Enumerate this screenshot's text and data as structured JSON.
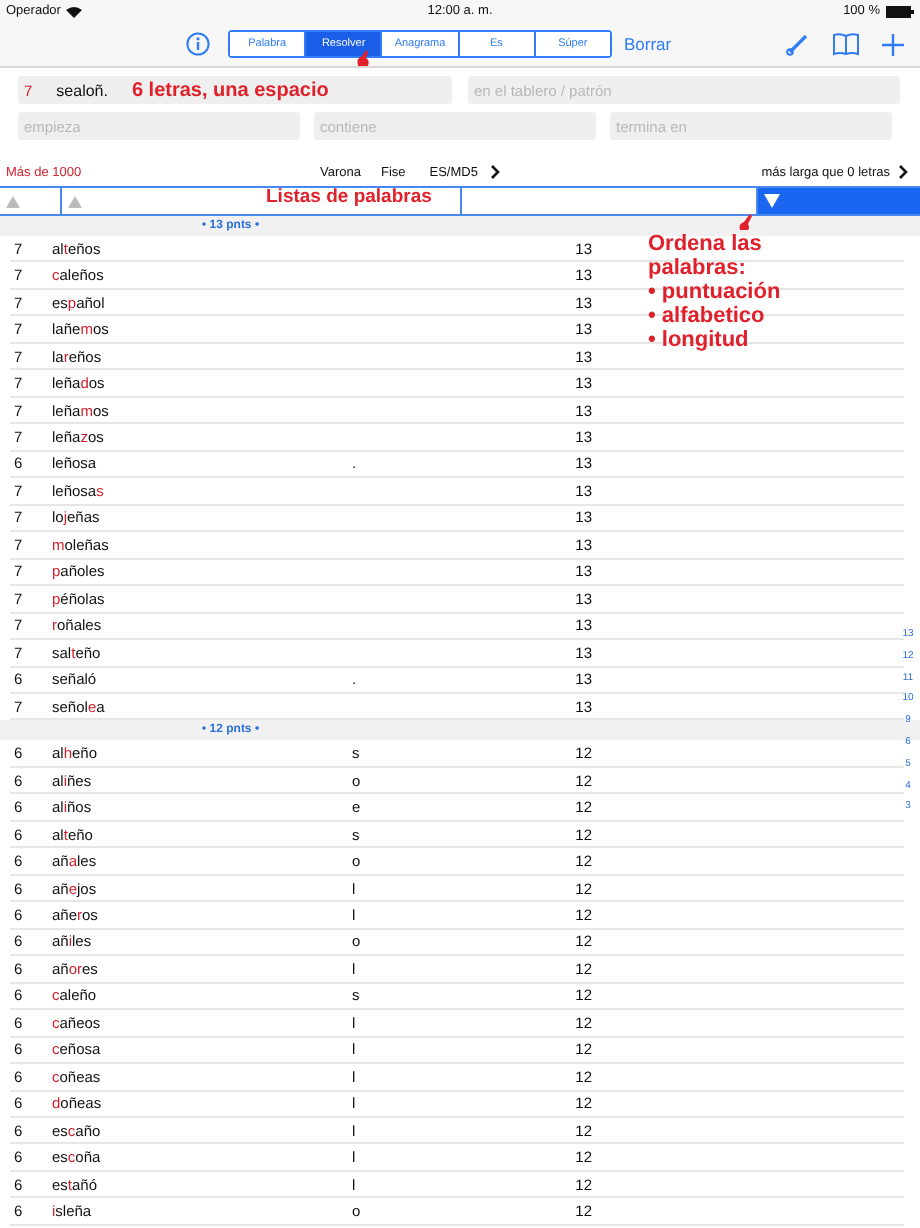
{
  "status_bar": {
    "carrier": "Operador",
    "time": "12:00 a. m.",
    "battery": "100 %"
  },
  "toolbar": {
    "modes": [
      {
        "label": "Palabra",
        "selected": false
      },
      {
        "label": "Resolver",
        "selected": true
      },
      {
        "label": "Anagrama",
        "selected": false
      },
      {
        "label": "Es",
        "selected": false
      },
      {
        "label": "Súper",
        "selected": false
      }
    ],
    "clear_button": "Borrar"
  },
  "search": {
    "count": "7",
    "value": "sealoñ.",
    "annotation": "6 letras, una espacio",
    "pattern_placeholder": "en el tablero / patrón",
    "starts_placeholder": "empieza",
    "contains_placeholder": "contiene",
    "ends_placeholder": "termina en"
  },
  "filters": {
    "result_count": "Más de 1000",
    "dictionaries": [
      "Varona",
      "Fise",
      "ES/MD5"
    ],
    "length_filter": "más larga que 0 letras"
  },
  "sort_header": {
    "annotation": "Listas de palabras",
    "columns": [
      {
        "arrow": true,
        "selected": false
      },
      {
        "arrow": true,
        "selected": false
      },
      {
        "arrow": false,
        "selected": false
      },
      {
        "arrow": true,
        "selected": true
      }
    ]
  },
  "sort_note": [
    "Ordena las",
    "palabras:",
    "• puntuación",
    "• alfabetico",
    "• longitud"
  ],
  "groups": [
    {
      "header": "• 13 pnts •",
      "rows": [
        {
          "length": "7",
          "word": [
            {
              "text": "al",
              "red": false
            },
            {
              "text": "t",
              "red": true
            },
            {
              "text": "eños",
              "red": false
            }
          ],
          "score": "13"
        },
        {
          "length": "7",
          "word": [
            {
              "text": "c",
              "red": true
            },
            {
              "text": "aleños",
              "red": false
            }
          ],
          "score": "13"
        },
        {
          "length": "7",
          "word": [
            {
              "text": "es",
              "red": false
            },
            {
              "text": "p",
              "red": true
            },
            {
              "text": "añol",
              "red": false
            }
          ],
          "score": "13"
        },
        {
          "length": "7",
          "word": [
            {
              "text": "lañe",
              "red": false
            },
            {
              "text": "m",
              "red": true
            },
            {
              "text": "os",
              "red": false
            }
          ],
          "score": "13"
        },
        {
          "length": "7",
          "word": [
            {
              "text": "la",
              "red": false
            },
            {
              "text": "r",
              "red": true
            },
            {
              "text": "eños",
              "red": false
            }
          ],
          "score": "13"
        },
        {
          "length": "7",
          "word": [
            {
              "text": "leña",
              "red": false
            },
            {
              "text": "d",
              "red": true
            },
            {
              "text": "os",
              "red": false
            }
          ],
          "score": "13"
        },
        {
          "length": "7",
          "word": [
            {
              "text": "leña",
              "red": false
            },
            {
              "text": "m",
              "red": true
            },
            {
              "text": "os",
              "red": false
            }
          ],
          "score": "13"
        },
        {
          "length": "7",
          "word": [
            {
              "text": "leña",
              "red": false
            },
            {
              "text": "z",
              "red": true
            },
            {
              "text": "os",
              "red": false
            }
          ],
          "score": "13"
        },
        {
          "length": "6",
          "word": [
            {
              "text": "leñosa",
              "red": false
            }
          ],
          "extra": ".",
          "score": "13"
        },
        {
          "length": "7",
          "word": [
            {
              "text": "leñosa",
              "red": false
            },
            {
              "text": "s",
              "red": true
            }
          ],
          "score": "13"
        },
        {
          "length": "7",
          "word": [
            {
              "text": "lo",
              "red": false
            },
            {
              "text": "j",
              "red": true
            },
            {
              "text": "eñas",
              "red": false
            }
          ],
          "score": "13"
        },
        {
          "length": "7",
          "word": [
            {
              "text": "m",
              "red": true
            },
            {
              "text": "oleñas",
              "red": false
            }
          ],
          "score": "13"
        },
        {
          "length": "7",
          "word": [
            {
              "text": "p",
              "red": true
            },
            {
              "text": "añoles",
              "red": false
            }
          ],
          "score": "13"
        },
        {
          "length": "7",
          "word": [
            {
              "text": "p",
              "red": true
            },
            {
              "text": "éñolas",
              "red": false
            }
          ],
          "score": "13"
        },
        {
          "length": "7",
          "word": [
            {
              "text": "r",
              "red": true
            },
            {
              "text": "oñales",
              "red": false
            }
          ],
          "score": "13"
        },
        {
          "length": "7",
          "word": [
            {
              "text": "sal",
              "red": false
            },
            {
              "text": "t",
              "red": true
            },
            {
              "text": "eño",
              "red": false
            }
          ],
          "score": "13"
        },
        {
          "length": "6",
          "word": [
            {
              "text": "señaló",
              "red": false
            }
          ],
          "extra": ".",
          "score": "13"
        },
        {
          "length": "7",
          "word": [
            {
              "text": "señol",
              "red": false
            },
            {
              "text": "e",
              "red": true
            },
            {
              "text": "a",
              "red": false
            }
          ],
          "score": "13"
        }
      ]
    },
    {
      "header": "• 12 pnts •",
      "rows": [
        {
          "length": "6",
          "word": [
            {
              "text": "al",
              "red": false
            },
            {
              "text": "h",
              "red": true
            },
            {
              "text": "eño",
              "red": false
            }
          ],
          "extra": "s",
          "score": "12"
        },
        {
          "length": "6",
          "word": [
            {
              "text": "al",
              "red": false
            },
            {
              "text": "i",
              "red": true
            },
            {
              "text": "ñes",
              "red": false
            }
          ],
          "extra": "o",
          "score": "12"
        },
        {
          "length": "6",
          "word": [
            {
              "text": "al",
              "red": false
            },
            {
              "text": "i",
              "red": true
            },
            {
              "text": "ños",
              "red": false
            }
          ],
          "extra": "e",
          "score": "12"
        },
        {
          "length": "6",
          "word": [
            {
              "text": "al",
              "red": false
            },
            {
              "text": "t",
              "red": true
            },
            {
              "text": "eño",
              "red": false
            }
          ],
          "extra": "s",
          "score": "12"
        },
        {
          "length": "6",
          "word": [
            {
              "text": "añ",
              "red": false
            },
            {
              "text": "a",
              "red": true
            },
            {
              "text": "les",
              "red": false
            }
          ],
          "extra": "o",
          "score": "12"
        },
        {
          "length": "6",
          "word": [
            {
              "text": "añ",
              "red": false
            },
            {
              "text": "e",
              "red": true
            },
            {
              "text": "jos",
              "red": false
            }
          ],
          "extra": "l",
          "score": "12"
        },
        {
          "length": "6",
          "word": [
            {
              "text": "añe",
              "red": false
            },
            {
              "text": "r",
              "red": true
            },
            {
              "text": "os",
              "red": false
            }
          ],
          "extra": "l",
          "score": "12"
        },
        {
          "length": "6",
          "word": [
            {
              "text": "añ",
              "red": false
            },
            {
              "text": "i",
              "red": true
            },
            {
              "text": "les",
              "red": false
            }
          ],
          "extra": "o",
          "score": "12"
        },
        {
          "length": "6",
          "word": [
            {
              "text": "añ",
              "red": false
            },
            {
              "text": "or",
              "red": true
            },
            {
              "text": "es",
              "red": false
            }
          ],
          "extra": "l",
          "score": "12"
        },
        {
          "length": "6",
          "word": [
            {
              "text": "c",
              "red": true
            },
            {
              "text": "aleño",
              "red": false
            }
          ],
          "extra": "s",
          "score": "12"
        },
        {
          "length": "6",
          "word": [
            {
              "text": "c",
              "red": true
            },
            {
              "text": "añeos",
              "red": false
            }
          ],
          "extra": "l",
          "score": "12"
        },
        {
          "length": "6",
          "word": [
            {
              "text": "c",
              "red": true
            },
            {
              "text": "eñosa",
              "red": false
            }
          ],
          "extra": "l",
          "score": "12"
        },
        {
          "length": "6",
          "word": [
            {
              "text": "c",
              "red": true
            },
            {
              "text": "oñeas",
              "red": false
            }
          ],
          "extra": "l",
          "score": "12"
        },
        {
          "length": "6",
          "word": [
            {
              "text": "d",
              "red": true
            },
            {
              "text": "oñeas",
              "red": false
            }
          ],
          "extra": "l",
          "score": "12"
        },
        {
          "length": "6",
          "word": [
            {
              "text": "es",
              "red": false
            },
            {
              "text": "c",
              "red": true
            },
            {
              "text": "año",
              "red": false
            }
          ],
          "extra": "l",
          "score": "12"
        },
        {
          "length": "6",
          "word": [
            {
              "text": "es",
              "red": false
            },
            {
              "text": "c",
              "red": true
            },
            {
              "text": "oña",
              "red": false
            }
          ],
          "extra": "l",
          "score": "12"
        },
        {
          "length": "6",
          "word": [
            {
              "text": "es",
              "red": false
            },
            {
              "text": "t",
              "red": true
            },
            {
              "text": "añó",
              "red": false
            }
          ],
          "extra": "l",
          "score": "12"
        },
        {
          "length": "6",
          "word": [
            {
              "text": "i",
              "red": true
            },
            {
              "text": "sleña",
              "red": false
            }
          ],
          "extra": "o",
          "score": "12"
        }
      ]
    }
  ],
  "section_index": [
    "13",
    "12",
    "11",
    "10",
    "9",
    "6",
    "5",
    "4",
    "3"
  ]
}
